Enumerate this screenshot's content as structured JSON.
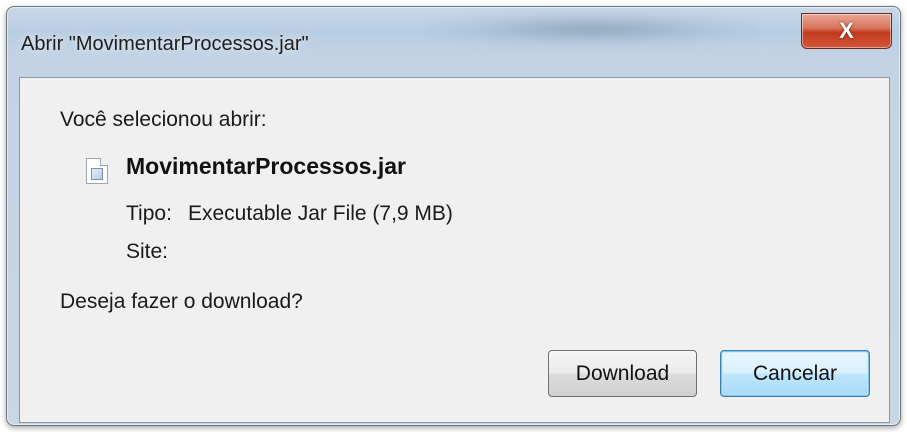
{
  "window": {
    "title": "Abrir \"MovimentarProcessos.jar\"",
    "close_glyph": "X"
  },
  "dialog": {
    "intro": "Você selecionou abrir:",
    "file_icon": "jar-file-icon",
    "file_name": "MovimentarProcessos.jar",
    "type_label": "Tipo:",
    "type_value": "Executable Jar File (7,9 MB)",
    "site_label": "Site:",
    "site_value": "",
    "question": "Deseja fazer o download?"
  },
  "buttons": {
    "download": "Download",
    "cancel": "Cancelar"
  },
  "colors": {
    "close_button": "#c13a1e",
    "default_button_border": "#3c7fb1",
    "client_background": "#f0f0f0"
  }
}
